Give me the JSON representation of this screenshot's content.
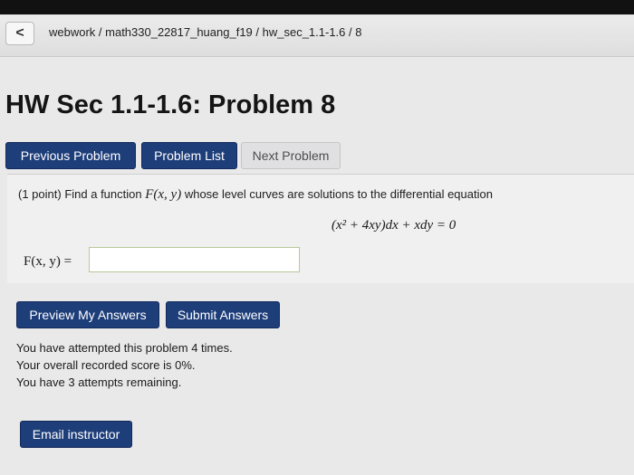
{
  "breadcrumb": {
    "back_glyph": "<",
    "path": "webwork / math330_22817_huang_f19 / hw_sec_1.1-1.6 / 8"
  },
  "page_title": "HW Sec 1.1-1.6: Problem 8",
  "nav": {
    "previous": "Previous Problem",
    "list": "Problem List",
    "next": "Next Problem"
  },
  "problem": {
    "points": "(1 point)",
    "prompt_before": "Find a function",
    "function_name": "F(x, y)",
    "prompt_after": "whose level curves are solutions to the differential equation",
    "equation": "(x² + 4xy)dx + xdy = 0",
    "answer_label": "F(x, y) =",
    "answer_value": ""
  },
  "actions": {
    "preview": "Preview My Answers",
    "submit": "Submit Answers"
  },
  "status": {
    "attempts": "You have attempted this problem 4 times.",
    "score": "Your overall recorded score is 0%.",
    "remaining": "You have 3 attempts remaining."
  },
  "email_instructor": "Email instructor",
  "colors": {
    "button_dark": "#1e3e7a",
    "button_disabled": "#e0e0e2",
    "page_background": "#e9e9ea"
  }
}
